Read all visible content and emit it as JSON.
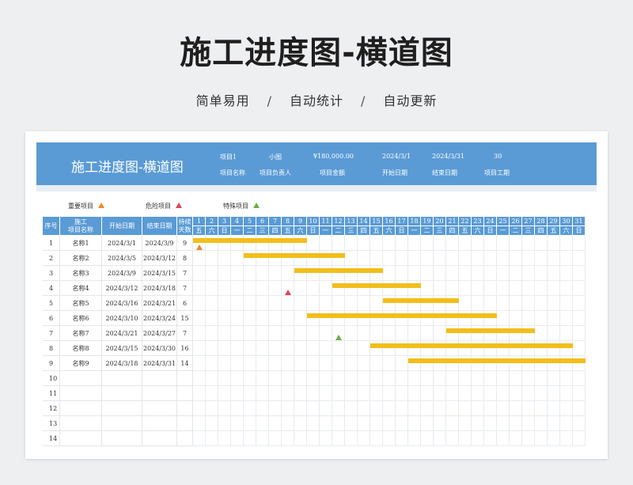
{
  "title": "施工进度图-横道图",
  "features": [
    "简单易用",
    "自动统计",
    "自动更新"
  ],
  "separator": "/",
  "banner": {
    "title": "施工进度图-横道图",
    "values": [
      "项目1",
      "小图",
      "¥180,000.00",
      "2024/3/1",
      "2024/3/31",
      "30"
    ],
    "labels": [
      "项目名称",
      "项目负责人",
      "项目金额",
      "开始日期",
      "结束日期",
      "项目工期"
    ]
  },
  "legend": [
    {
      "label": "重要项目",
      "color": "#e98b2a"
    },
    {
      "label": "危险项目",
      "color": "#e0465a"
    },
    {
      "label": "特殊项目",
      "color": "#6ab04c"
    }
  ],
  "headers": {
    "index": "序号",
    "name_line1": "施工",
    "name_line2": "项目名称",
    "start": "开始日期",
    "end": "结束日期",
    "dur_line1": "持续",
    "dur_line2": "天数"
  },
  "days": [
    "1",
    "2",
    "3",
    "4",
    "5",
    "6",
    "7",
    "8",
    "9",
    "10",
    "11",
    "12",
    "13",
    "14",
    "15",
    "16",
    "17",
    "18",
    "19",
    "20",
    "21",
    "22",
    "23",
    "24",
    "25",
    "26",
    "27",
    "28",
    "29",
    "30",
    "31"
  ],
  "weekdays": [
    "五",
    "六",
    "日",
    "一",
    "二",
    "三",
    "四",
    "五",
    "六",
    "日",
    "一",
    "二",
    "三",
    "四",
    "五",
    "六",
    "日",
    "一",
    "二",
    "三",
    "四",
    "五",
    "六",
    "日",
    "一",
    "二",
    "三",
    "四",
    "五",
    "六",
    "日"
  ],
  "colors": {
    "header": "#5a9bd5",
    "bar": "#f2be1a"
  },
  "rows": [
    {
      "idx": "1",
      "name": "名称1",
      "start": "2024/3/1",
      "end": "2024/3/9",
      "dur": "9",
      "bar": [
        1,
        9
      ],
      "marker": {
        "type": "重要项目",
        "day": 1
      }
    },
    {
      "idx": "2",
      "name": "名称2",
      "start": "2024/3/5",
      "end": "2024/3/12",
      "dur": "8",
      "bar": [
        5,
        12
      ]
    },
    {
      "idx": "3",
      "name": "名称3",
      "start": "2024/3/9",
      "end": "2024/3/15",
      "dur": "7",
      "bar": [
        9,
        15
      ]
    },
    {
      "idx": "4",
      "name": "名称4",
      "start": "2024/3/12",
      "end": "2024/3/18",
      "dur": "7",
      "bar": [
        12,
        18
      ],
      "marker": {
        "type": "危险项目",
        "day": 8
      }
    },
    {
      "idx": "5",
      "name": "名称5",
      "start": "2024/3/16",
      "end": "2024/3/21",
      "dur": "6",
      "bar": [
        16,
        21
      ]
    },
    {
      "idx": "6",
      "name": "名称6",
      "start": "2024/3/10",
      "end": "2024/3/24",
      "dur": "15",
      "bar": [
        10,
        24
      ]
    },
    {
      "idx": "7",
      "name": "名称7",
      "start": "2024/3/21",
      "end": "2024/3/27",
      "dur": "7",
      "bar": [
        21,
        27
      ],
      "marker": {
        "type": "特殊项目",
        "day": 12
      }
    },
    {
      "idx": "8",
      "name": "名称8",
      "start": "2024/3/15",
      "end": "2024/3/30",
      "dur": "16",
      "bar": [
        15,
        30
      ]
    },
    {
      "idx": "9",
      "name": "名称9",
      "start": "2024/3/18",
      "end": "2024/3/31",
      "dur": "14",
      "bar": [
        18,
        31
      ]
    },
    {
      "idx": "10",
      "name": "",
      "start": "",
      "end": "",
      "dur": ""
    },
    {
      "idx": "11",
      "name": "",
      "start": "",
      "end": "",
      "dur": ""
    },
    {
      "idx": "12",
      "name": "",
      "start": "",
      "end": "",
      "dur": ""
    },
    {
      "idx": "13",
      "name": "",
      "start": "",
      "end": "",
      "dur": ""
    },
    {
      "idx": "14",
      "name": "",
      "start": "",
      "end": "",
      "dur": ""
    }
  ]
}
